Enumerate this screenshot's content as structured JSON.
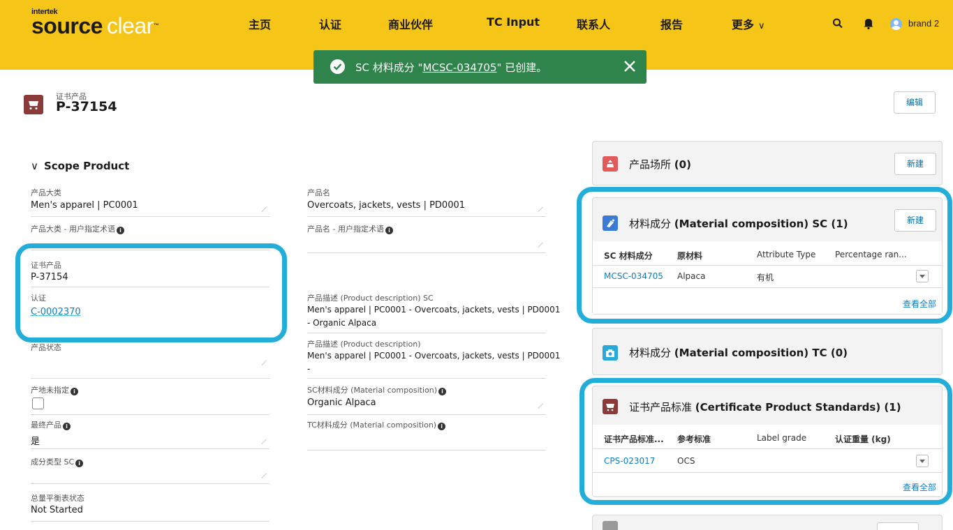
{
  "app": {
    "logo_small": "intertek",
    "logo_word1": "source",
    "logo_word2": "clear",
    "logo_tm": "™"
  },
  "nav": {
    "home": "主页",
    "certification": "认证",
    "partners": "商业伙伴",
    "tc_input": "TC Input",
    "contacts": "联系人",
    "reports": "报告",
    "more": "更多"
  },
  "user": {
    "name": "brand 2"
  },
  "toast": {
    "prefix": "SC 材料成分 \"",
    "link": "MCSC-034705",
    "suffix": "\" 已创建。",
    "bg_color": "#2e844a"
  },
  "record": {
    "type": "证书产品",
    "name": "P-37154",
    "edit_label": "编辑"
  },
  "section": {
    "title": "Scope Product"
  },
  "fields": {
    "category_label": "产品大类",
    "category_value": "Men's apparel | PC0001",
    "category_user_label": "产品大类 - 用户指定术语",
    "cert_product_label": "证书产品",
    "cert_product_value": "P-37154",
    "certification_label": "认证",
    "certification_value": "C-0002370",
    "status_label": "产品状态",
    "origin_label": "产地未指定",
    "final_label": "最终产品",
    "final_value": "是",
    "comp_type_label": "成分类型 SC",
    "mass_balance_label": "总量平衡表状态",
    "mass_balance_value": "Not Started",
    "product_name_label": "产品名",
    "product_name_value": "Overcoats, jackets, vests | PD0001",
    "product_name_user_label": "产品名 - 用户指定术语",
    "desc_sc_label": "产品描述 (Product description) SC",
    "desc_sc_line1": "Men's apparel | PC0001 - Overcoats, jackets, vests | PD0001",
    "desc_sc_line2": "- Organic Alpaca",
    "desc_label": "产品描述 (Product description)",
    "desc_line1": "Men's apparel | PC0001 - Overcoats, jackets, vests | PD0001",
    "desc_line2": "-",
    "sc_comp_label": "SC材料成分 (Material composition)",
    "sc_comp_value": "Organic Alpaca",
    "tc_comp_label": "TC材料成分 (Material composition)"
  },
  "cards": {
    "sites": {
      "title": "产品场所",
      "count": "(0)",
      "new_label": "新建"
    },
    "sc_comp": {
      "title": "材料成分",
      "title_en": "(Material composition) SC (1)",
      "new_label": "新建",
      "columns": [
        "SC 材料成分",
        "原材料",
        "Attribute Type",
        "Percentage ran..."
      ],
      "rows": [
        [
          "MCSC-034705",
          "Alpaca",
          "有机",
          ""
        ]
      ],
      "view_all": "查看全部"
    },
    "tc_comp": {
      "title": "材料成分",
      "title_en": "(Material composition) TC (0)"
    },
    "standards": {
      "title": "证书产品标准",
      "title_en": "(Certificate Product Standards) (1)",
      "columns": [
        "证书产品标准...",
        "参考标准",
        "Label grade",
        "认证重量 (kg)"
      ],
      "rows": [
        [
          "CPS-023017",
          "OCS",
          "",
          ""
        ]
      ],
      "view_all": "查看全部"
    }
  },
  "colors": {
    "header_bg": "#f5c518",
    "highlight": "#22aed8",
    "link": "#0b7ec2"
  }
}
